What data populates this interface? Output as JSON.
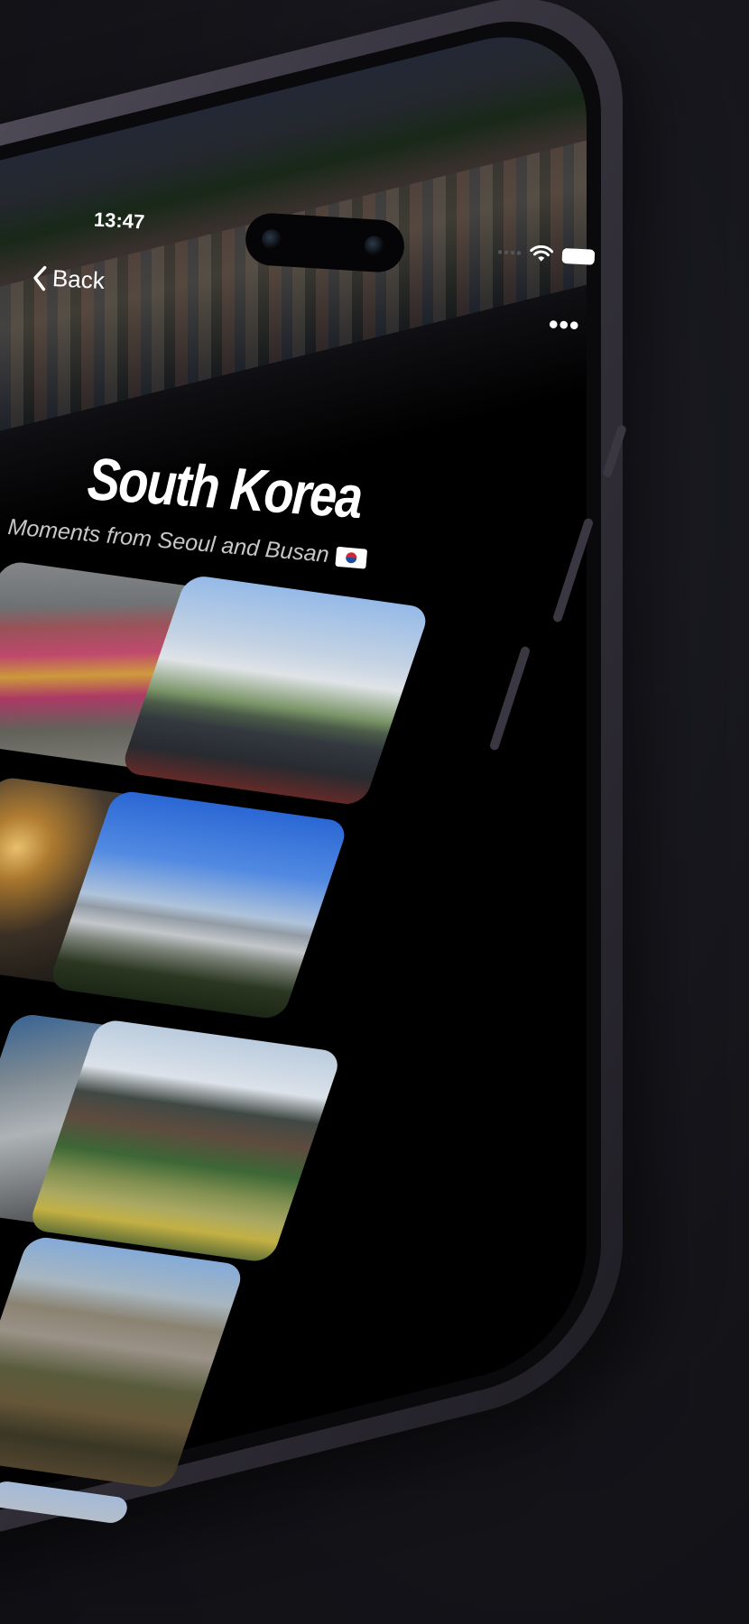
{
  "status_bar": {
    "time": "13:47",
    "icons": [
      "signal-icon",
      "wifi-icon",
      "battery-icon"
    ]
  },
  "nav": {
    "back_label": "Back",
    "more_label": "•••"
  },
  "header": {
    "title": "South Korea",
    "subtitle": "Moments from Seoul and Busan"
  },
  "photos": [
    {
      "name": "photo-flower-road"
    },
    {
      "name": "photo-palace-mountain"
    },
    {
      "name": "photo-night-lights"
    },
    {
      "name": "photo-city-skyline"
    },
    {
      "name": "photo-window-interior"
    },
    {
      "name": "photo-pavilion-pond"
    },
    {
      "name": "photo-autumn-trees"
    },
    {
      "name": "photo-partial-bottom"
    }
  ],
  "colors": {
    "background": "#141419",
    "frame": "#3b3843",
    "screen": "#000000",
    "text": "#ffffff"
  }
}
